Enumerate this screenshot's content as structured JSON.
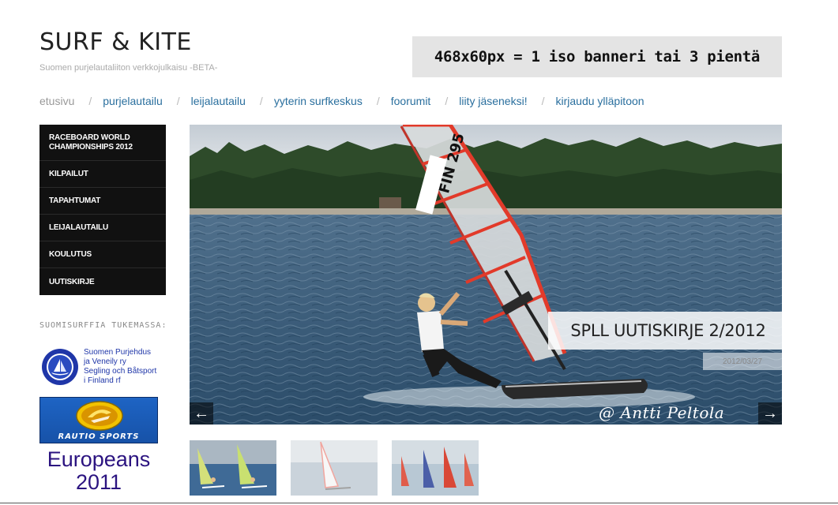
{
  "site": {
    "title": "SURF & KITE",
    "tagline": "Suomen purjelautaliiton verkkojulkaisu -BETA-"
  },
  "banner": {
    "text": "468x60px = 1 iso banneri tai 3 pientä"
  },
  "nav": {
    "items": [
      {
        "label": "etusivu",
        "current": true
      },
      {
        "label": "purjelautailu"
      },
      {
        "label": "leijalautailu"
      },
      {
        "label": "yyterin surfkeskus"
      },
      {
        "label": "foorumit"
      },
      {
        "label": "liity jäseneksi!"
      },
      {
        "label": "kirjaudu ylläpitoon"
      }
    ],
    "separator": "/"
  },
  "sidebar": {
    "menu": [
      {
        "label": "RACEBOARD WORLD CHAMPIONSHIPS 2012"
      },
      {
        "label": "KILPAILUT"
      },
      {
        "label": "TAPAHTUMAT"
      },
      {
        "label": "LEIJALAUTAILU"
      },
      {
        "label": "KOULUTUS"
      },
      {
        "label": "UUTISKIRJE"
      }
    ],
    "sponsors_heading": "SUOMISURFFIA TUKEMASSA:",
    "spll": {
      "line1": "Suomen Purjehdus",
      "line2": "ja Veneily ry",
      "line3": "Segling och Båtsport",
      "line4": "i Finland rf"
    },
    "rautio": {
      "wordmark": "RAUTIO SPORTS"
    },
    "europeans": {
      "line1": "Europeans",
      "line2": "2011"
    }
  },
  "slider": {
    "caption": "SPLL UUTISKIRJE 2/2012",
    "date": "2012/03/27",
    "credit": "@ Antti Peltola",
    "sail_number": "FIN 295",
    "prev_label": "←",
    "next_label": "→",
    "thumbnails": [
      {
        "name": "thumb-1",
        "active": true
      },
      {
        "name": "thumb-2",
        "active": false
      },
      {
        "name": "thumb-3",
        "active": true
      }
    ]
  },
  "colors": {
    "link": "#2a6f9e",
    "menu_bg": "#111111",
    "europeans": "#2b1380",
    "spll_text": "#1f36a8"
  }
}
